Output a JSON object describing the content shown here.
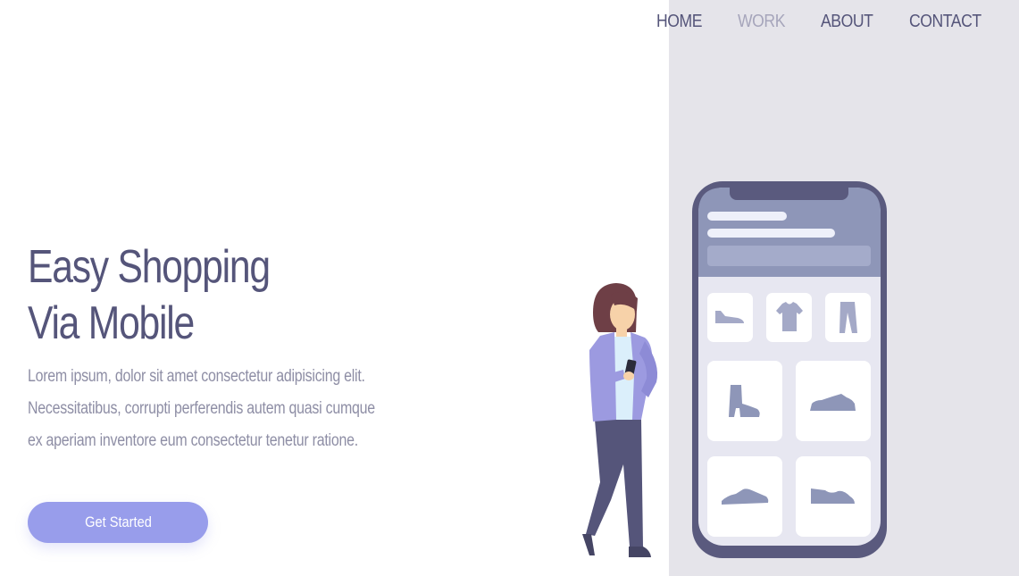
{
  "nav": {
    "items": [
      {
        "label": "HOME",
        "active": false
      },
      {
        "label": "WORK",
        "active": true
      },
      {
        "label": "ABOUT",
        "active": false
      },
      {
        "label": "CONTACT",
        "active": false
      }
    ]
  },
  "hero": {
    "title_line1": "Easy Shopping",
    "title_line2": "Via Mobile",
    "description": "Lorem ipsum, dolor sit amet consectetur adipisicing elit. Necessitatibus, corrupti perferendis autem quasi cumque ex aperiam inventore eum consectetur tenetur ratione.",
    "cta_label": "Get Started"
  },
  "colors": {
    "accent": "#989deb",
    "heading": "#55557a",
    "body_text": "#8e8ea5",
    "nav_active": "#a6a5bb",
    "panel_bg": "#e5e4ea"
  },
  "illustration": {
    "phone_items": [
      "sneaker-icon",
      "tshirt-icon",
      "pants-icon",
      "boot-icon",
      "shoe-icon",
      "sneaker-icon",
      "shoe-icon"
    ],
    "person": "woman-with-phone"
  }
}
